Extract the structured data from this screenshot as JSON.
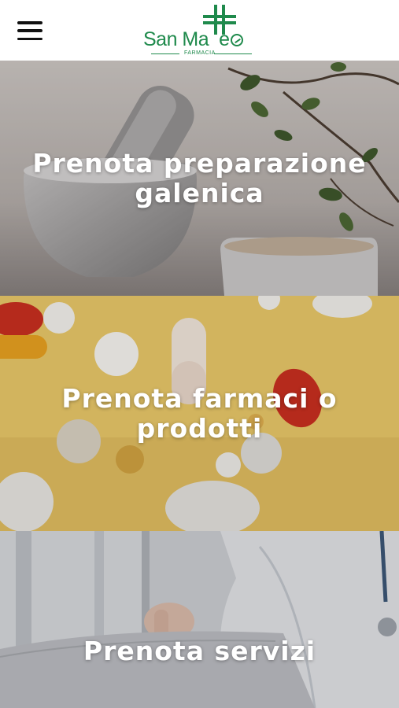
{
  "header": {
    "menu_icon": "hamburger-menu-icon",
    "logo": {
      "name": "San Matteo",
      "subtitle": "FARMACIA",
      "brand_color": "#1f8a4c"
    }
  },
  "tiles": [
    {
      "title": "Prenota preparazione galenica",
      "image": "mortar-and-pestle-with-plant"
    },
    {
      "title": "Prenota farmaci o prodotti",
      "image": "assorted-pills-on-yellow"
    },
    {
      "title": "Prenota servizi",
      "image": "doctor-with-clipboard"
    }
  ]
}
